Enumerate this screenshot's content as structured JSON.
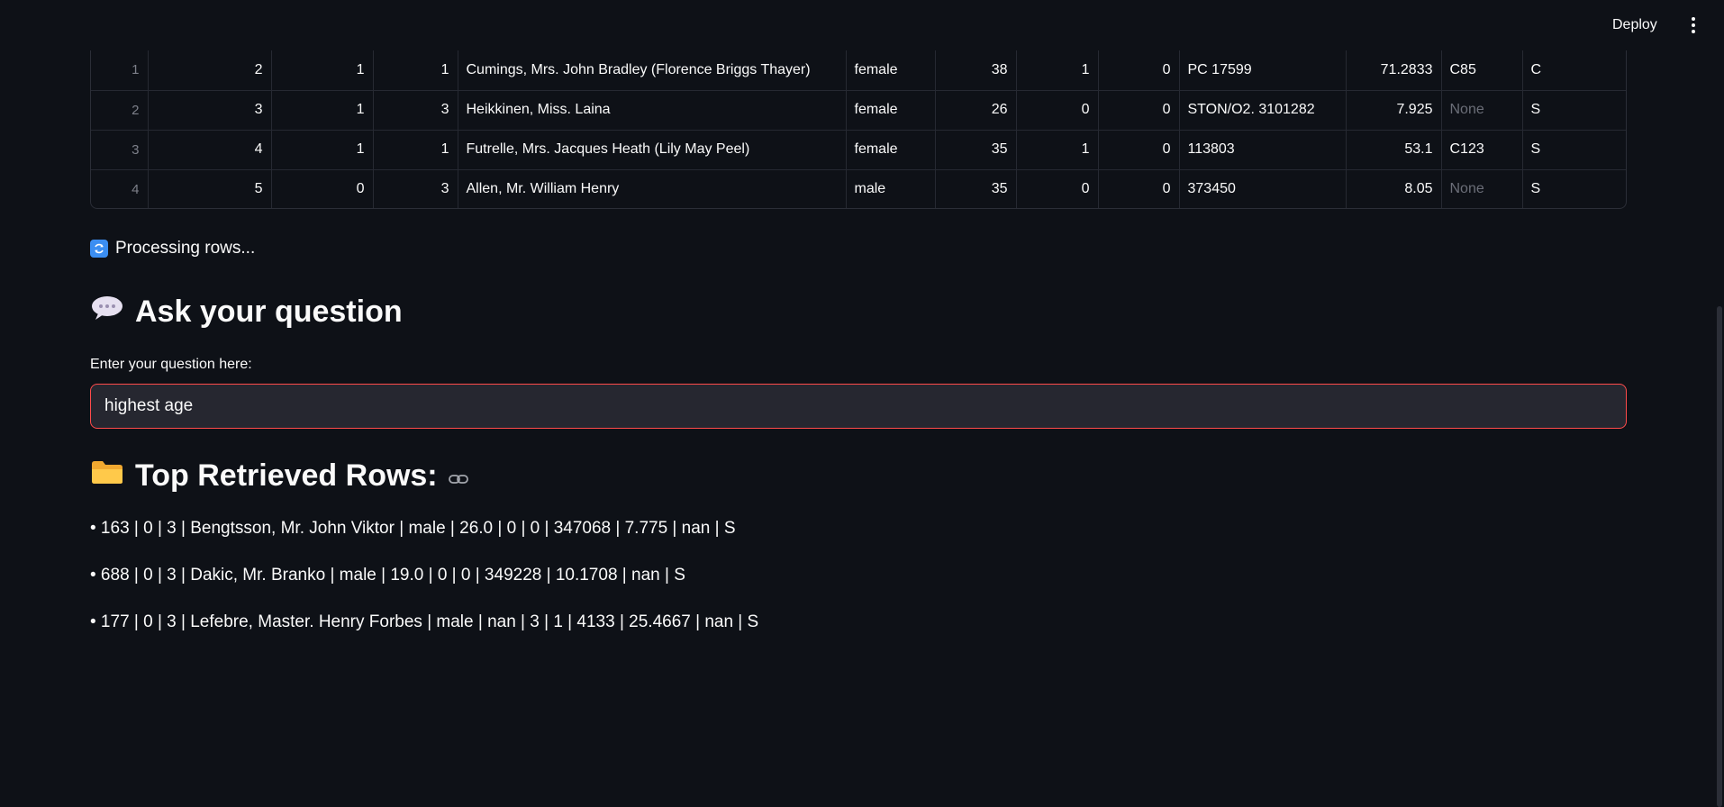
{
  "header": {
    "deploy_label": "Deploy",
    "menu_icon": "kebab-menu-icon"
  },
  "table": {
    "rows": [
      {
        "index": "1",
        "cells": [
          "2",
          "1",
          "1",
          "Cumings, Mrs. John Bradley (Florence Briggs Thayer)",
          "female",
          "38",
          "1",
          "0",
          "PC 17599",
          "71.2833",
          "C85",
          "C"
        ]
      },
      {
        "index": "2",
        "cells": [
          "3",
          "1",
          "3",
          "Heikkinen, Miss. Laina",
          "female",
          "26",
          "0",
          "0",
          "STON/O2. 3101282",
          "7.925",
          "None",
          "S"
        ]
      },
      {
        "index": "3",
        "cells": [
          "4",
          "1",
          "1",
          "Futrelle, Mrs. Jacques Heath (Lily May Peel)",
          "female",
          "35",
          "1",
          "0",
          "113803",
          "53.1",
          "C123",
          "S"
        ]
      },
      {
        "index": "4",
        "cells": [
          "5",
          "0",
          "3",
          "Allen, Mr. William Henry",
          "male",
          "35",
          "0",
          "0",
          "373450",
          "8.05",
          "None",
          "S"
        ]
      }
    ]
  },
  "status": {
    "text": "Processing rows...",
    "icon": "refresh-icon"
  },
  "ask": {
    "heading": "Ask your question",
    "heading_icon": "speech-bubble-icon",
    "input_label": "Enter your question here:",
    "input_value": "highest age"
  },
  "results": {
    "heading": "Top Retrieved Rows:",
    "heading_icon": "folder-icon",
    "link_icon": "link-icon",
    "items": [
      "• 163 | 0 | 3 | Bengtsson, Mr. John Viktor | male | 26.0 | 0 | 0 | 347068 | 7.775 | nan | S",
      "• 688 | 0 | 3 | Dakic, Mr. Branko | male | 19.0 | 0 | 0 | 349228 | 10.1708 | nan | S",
      "• 177 | 0 | 3 | Lefebre, Master. Henry Forbes | male | nan | 3 | 1 | 4133 | 25.4667 | nan | S"
    ]
  },
  "colors": {
    "background": "#0e1117",
    "input_border": "#ff4b4b",
    "input_bg": "#262730",
    "status_icon": "#3b8ef2"
  }
}
